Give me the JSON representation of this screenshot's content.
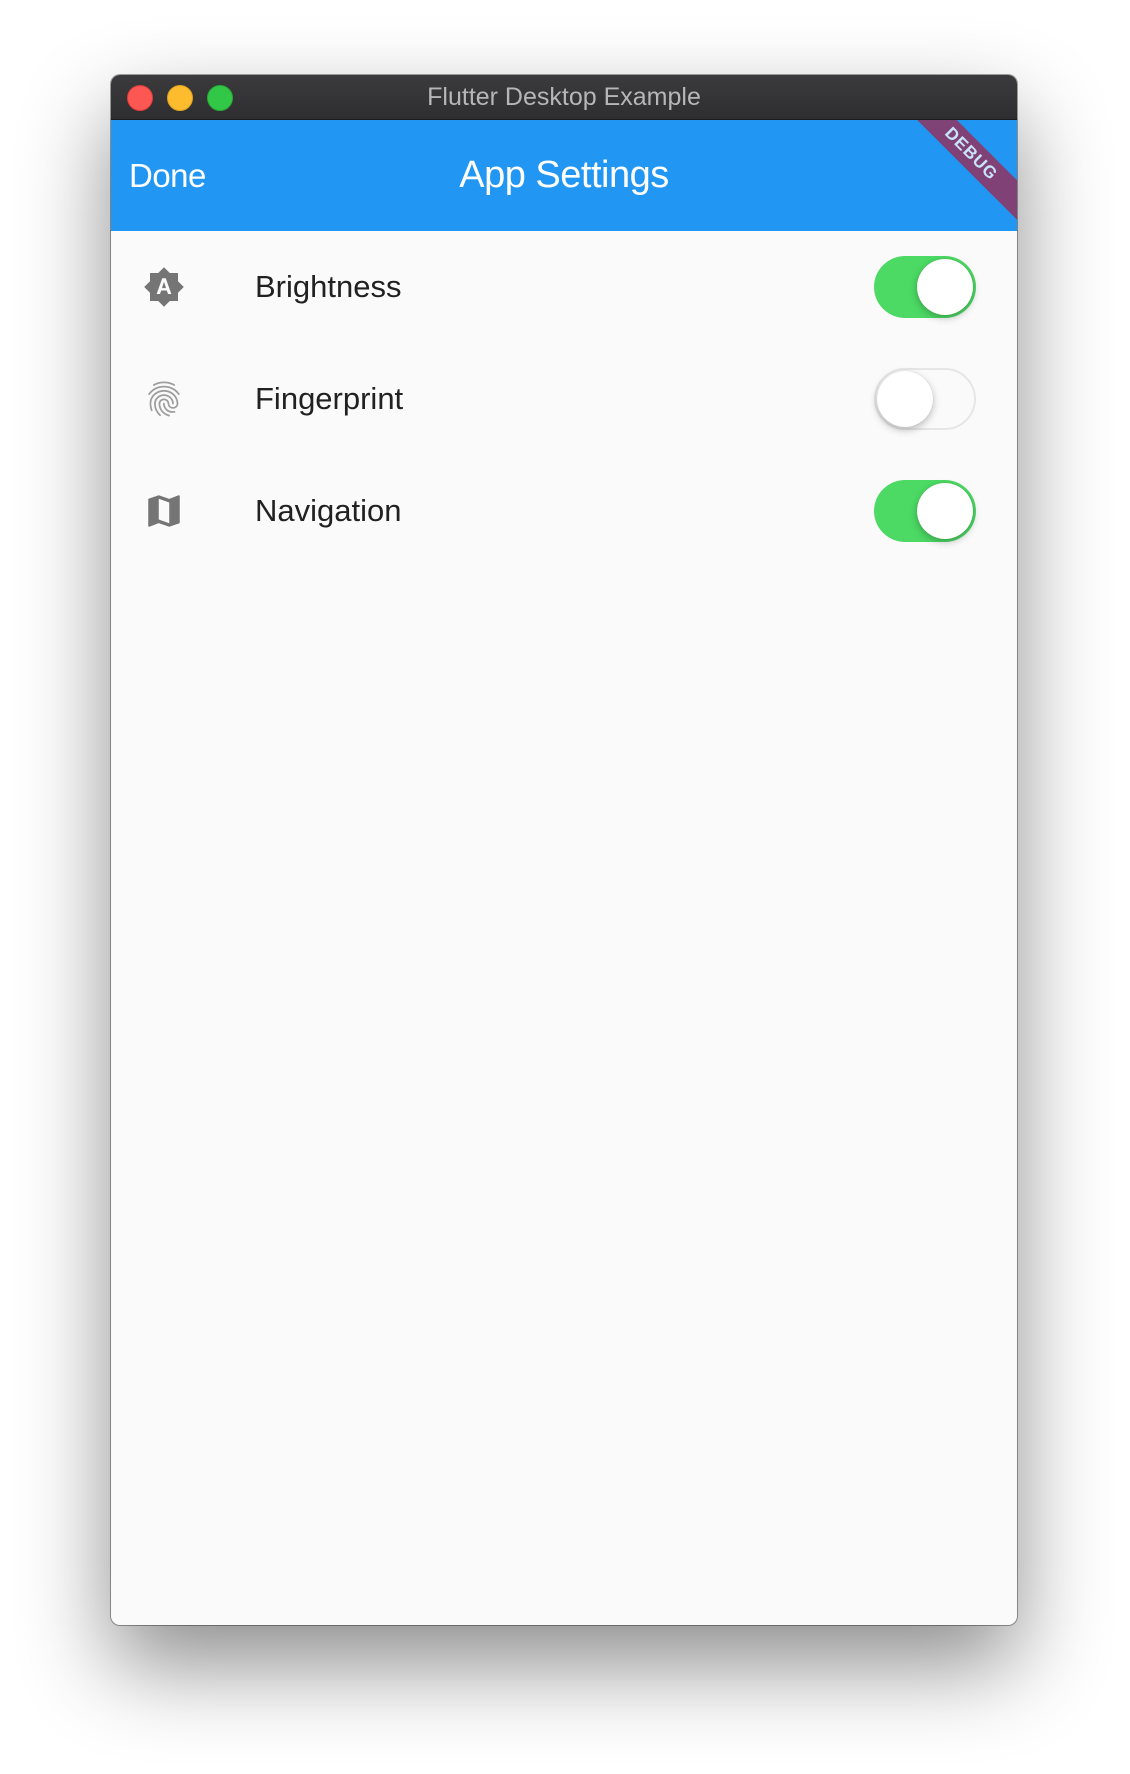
{
  "window": {
    "title": "Flutter Desktop Example"
  },
  "appbar": {
    "done_label": "Done",
    "title": "App Settings",
    "debug_banner": "DEBUG",
    "color": "#2196f3"
  },
  "settings": [
    {
      "label": "Brightness",
      "icon": "brightness-auto-icon",
      "enabled": true
    },
    {
      "label": "Fingerprint",
      "icon": "fingerprint-icon",
      "enabled": false
    },
    {
      "label": "Navigation",
      "icon": "map-icon",
      "enabled": true
    }
  ],
  "colors": {
    "switch_on": "#4cd964",
    "icon": "#757575"
  }
}
